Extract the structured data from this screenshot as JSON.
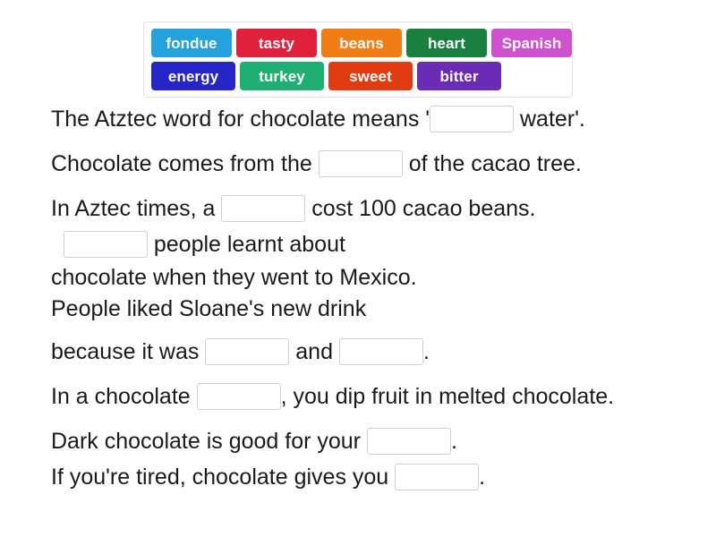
{
  "word_bank": {
    "rows": [
      [
        {
          "label": "fondue",
          "color": "#23a2dd"
        },
        {
          "label": "tasty",
          "color": "#e0213b"
        },
        {
          "label": "beans",
          "color": "#f07e14"
        },
        {
          "label": "heart",
          "color": "#1a8040"
        },
        {
          "label": "Spanish",
          "color": "#ce52ce"
        }
      ],
      [
        {
          "label": "energy",
          "color": "#2626c8"
        },
        {
          "label": "turkey",
          "color": "#1faf72"
        },
        {
          "label": "sweet",
          "color": "#e13b12"
        },
        {
          "label": "bitter",
          "color": "#6a2bb5"
        }
      ]
    ]
  },
  "sentences": [
    {
      "id": "line-1",
      "parts": [
        {
          "type": "text",
          "value": "The Atztec word for chocolate means '"
        },
        {
          "type": "blank",
          "value": ""
        },
        {
          "type": "text",
          "value": " water'."
        }
      ]
    },
    {
      "id": "line-2",
      "parts": [
        {
          "type": "text",
          "value": "Chocolate comes from the "
        },
        {
          "type": "blank",
          "value": ""
        },
        {
          "type": "text",
          "value": " of the cacao tree."
        }
      ]
    },
    {
      "id": "line-3",
      "parts": [
        {
          "type": "text",
          "value": "In Aztec times, a "
        },
        {
          "type": "blank",
          "value": ""
        },
        {
          "type": "text",
          "value": " cost 100 cacao beans."
        }
      ]
    },
    {
      "id": "line-4",
      "parts": [
        {
          "type": "text",
          "value": "  "
        },
        {
          "type": "blank",
          "value": ""
        },
        {
          "type": "text",
          "value": " people learnt about"
        }
      ]
    },
    {
      "id": "line-5",
      "parts": [
        {
          "type": "text",
          "value": "chocolate when they went to Mexico."
        }
      ]
    },
    {
      "id": "line-6",
      "parts": [
        {
          "type": "text",
          "value": "People liked Sloane's new drink"
        }
      ]
    },
    {
      "id": "line-7",
      "parts": [
        {
          "type": "text",
          "value": "because it was "
        },
        {
          "type": "blank",
          "value": ""
        },
        {
          "type": "text",
          "value": " and "
        },
        {
          "type": "blank",
          "value": ""
        },
        {
          "type": "text",
          "value": "."
        }
      ]
    },
    {
      "id": "line-8",
      "parts": [
        {
          "type": "text",
          "value": "In a chocolate "
        },
        {
          "type": "blank",
          "value": ""
        },
        {
          "type": "text",
          "value": ", you dip fruit in melted chocolate."
        }
      ]
    },
    {
      "id": "line-9",
      "parts": [
        {
          "type": "text",
          "value": "Dark chocolate is good for your "
        },
        {
          "type": "blank",
          "value": ""
        },
        {
          "type": "text",
          "value": "."
        }
      ]
    },
    {
      "id": "line-10",
      "parts": [
        {
          "type": "text",
          "value": "If you're tired, chocolate gives you "
        },
        {
          "type": "blank",
          "value": ""
        },
        {
          "type": "text",
          "value": "."
        }
      ]
    }
  ],
  "line_spacing": [
    "lg",
    "lg",
    "sm",
    "sm",
    "sm",
    "lg",
    "lg",
    "lg",
    "sm"
  ]
}
